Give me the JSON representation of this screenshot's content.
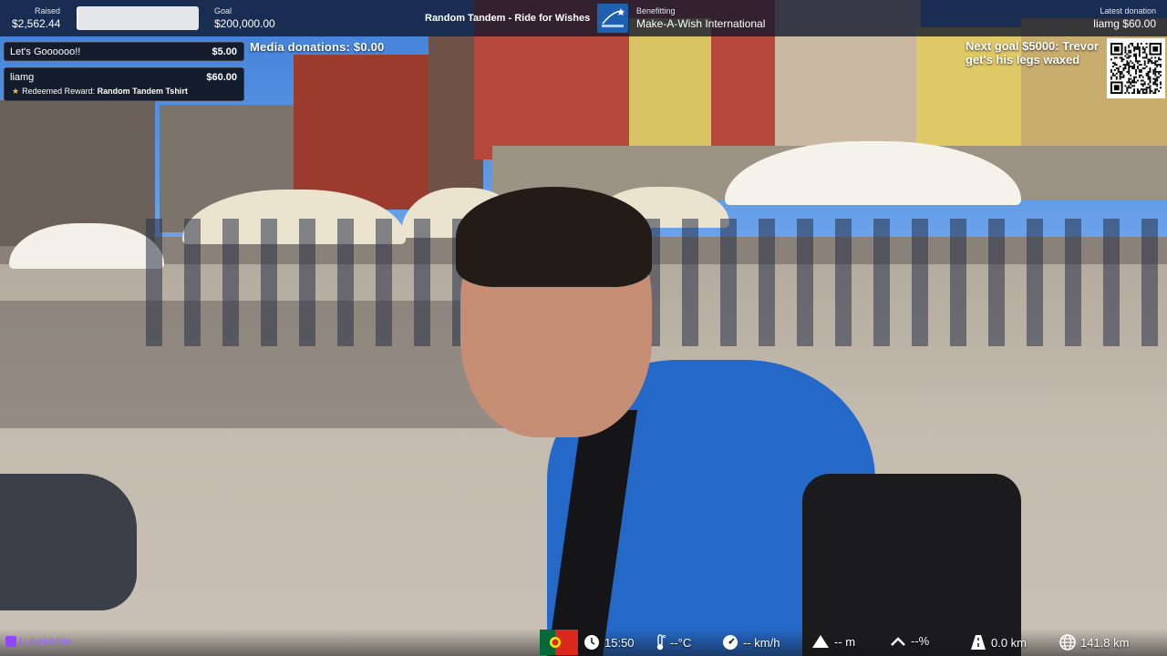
{
  "topbar": {
    "raised_label": "Raised",
    "raised_value": "$2,562.44",
    "progress_fraction": 0.0128,
    "goal_label": "Goal",
    "goal_value": "$200,000.00",
    "event_title": "Random Tandem - Ride for Wishes",
    "charity_logo_text": "Make-A-Wish",
    "beneficiary_label": "Benefitting",
    "beneficiary_name": "Make-A-Wish International",
    "latest_label": "Latest donation",
    "latest_value": "liamg $60.00"
  },
  "alerts": [
    {
      "donor": "Let's Goooooo!!",
      "amount": "$5.00"
    },
    {
      "donor": "liamg",
      "amount": "$60.00",
      "reward_prefix": "Redeemed Reward:",
      "reward_name": "Random Tandem Tshirt"
    }
  ],
  "media_donations": "Media donations: $0.00",
  "next_goal": "Next goal $5000: Trevor get's his legs waxed",
  "bottombar": {
    "streamer": "Lukekibble",
    "time": "15:50",
    "temperature": "--°C",
    "speed": "-- km/h",
    "altitude": "-- m",
    "incline": "--%",
    "distance": "0.0 km",
    "total_distance": "141.8 km"
  },
  "colors": {
    "topbar_bg": "#0e162c",
    "twitch_purple": "#9146ff",
    "charity_blue": "#1f5fb0",
    "star_gold": "#f0c23a"
  },
  "icons": [
    "star-icon",
    "twitch-icon",
    "portugal-flag-icon",
    "clock-icon",
    "thermometer-icon",
    "speedometer-icon",
    "mountain-icon",
    "incline-chevron-icon",
    "road-icon",
    "globe-icon",
    "qr-code-icon"
  ]
}
